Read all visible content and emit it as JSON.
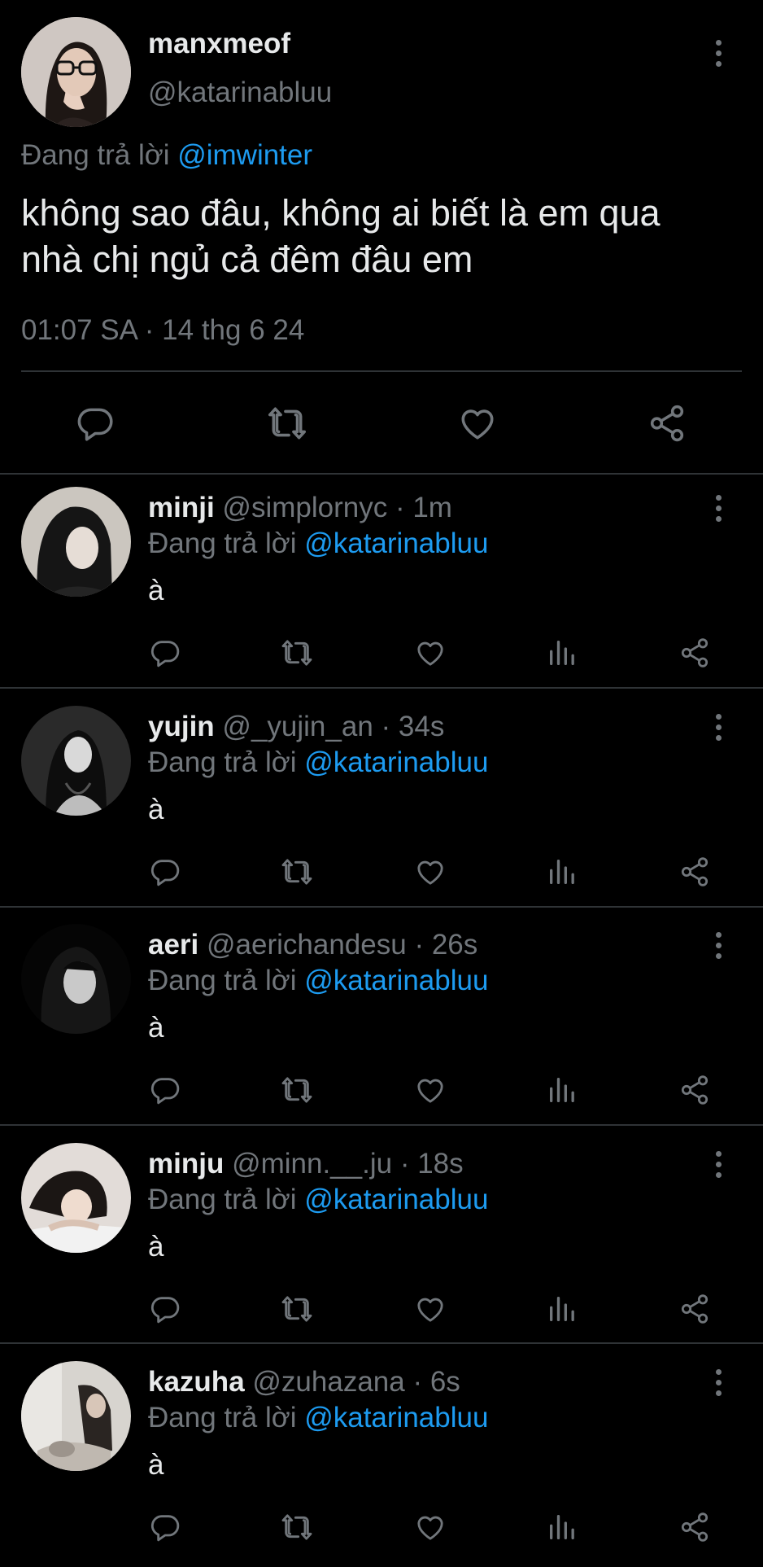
{
  "main_tweet": {
    "display_name": "manxmeof",
    "handle": "@katarinabluu",
    "replying_prefix": "Đang trả lời",
    "replying_to": "@imwinter",
    "text_line1": "không sao đâu, không ai biết là em qua",
    "text_line2": "nhà chị ngủ cả đêm đâu em",
    "timestamp": "01:07 SA · 14 thg 6 24"
  },
  "replies": [
    {
      "name": "minji",
      "handle": "@simplornyc",
      "time": "· 1m",
      "replying_prefix": "Đang trả lời",
      "replying_to": "@katarinabluu",
      "text": "à"
    },
    {
      "name": "yujin",
      "handle": "@_yujin_an",
      "time": "· 34s",
      "replying_prefix": "Đang trả lời",
      "replying_to": "@katarinabluu",
      "text": "à"
    },
    {
      "name": "aeri",
      "handle": "@aerichandesu",
      "time": "· 26s",
      "replying_prefix": "Đang trả lời",
      "replying_to": "@katarinabluu",
      "text": "à"
    },
    {
      "name": "minju",
      "handle": "@minn.__.ju",
      "time": "· 18s",
      "replying_prefix": "Đang trả lời",
      "replying_to": "@katarinabluu",
      "text": "à"
    },
    {
      "name": "kazuha",
      "handle": "@zuhazana",
      "time": "· 6s",
      "replying_prefix": "Đang trả lời",
      "replying_to": "@katarinabluu",
      "text": "à"
    }
  ],
  "colors": {
    "background": "#000000",
    "text": "#e7e9ea",
    "muted": "#71767b",
    "link": "#1d9bf0",
    "divider": "#2f3336"
  },
  "icons": [
    "reply-icon",
    "retweet-icon",
    "like-icon",
    "analytics-icon",
    "share-icon",
    "more-icon"
  ]
}
